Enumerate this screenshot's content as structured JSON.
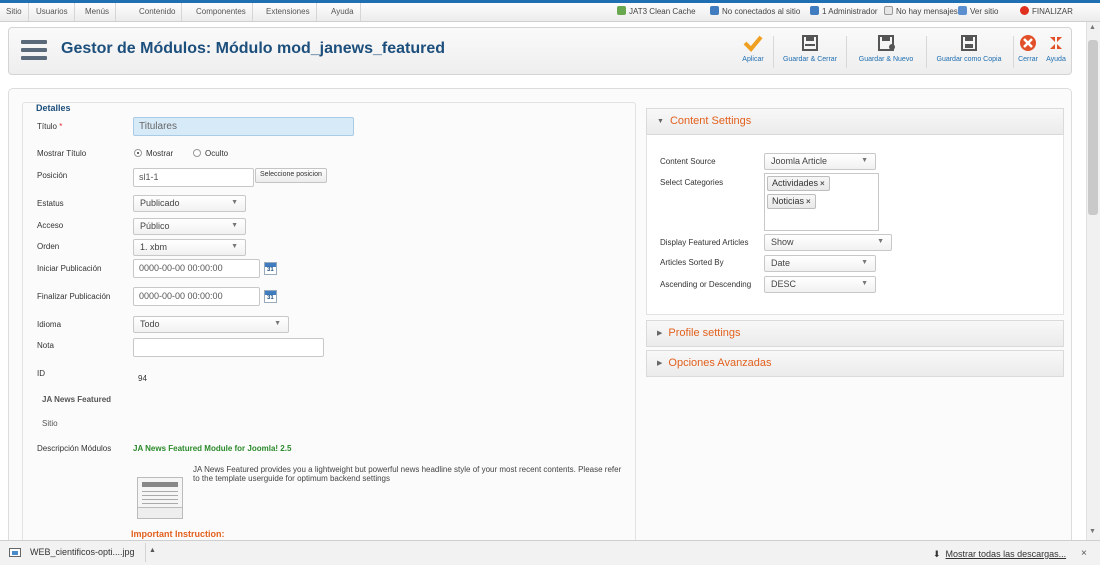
{
  "menu": [
    "Sitio",
    "Usuarios",
    "Menús",
    "Contenido",
    "Componentes",
    "Extensiones",
    "Ayuda"
  ],
  "status": {
    "cache": "JAT3 Clean Cache",
    "connected": "No conectados al sitio",
    "admins": "1 Administrador",
    "messages": "No hay mensajes",
    "view_site": "Ver sitio",
    "logout": "FINALIZAR"
  },
  "header": {
    "title": "Gestor de Módulos: Módulo mod_janews_featured",
    "toolbar": {
      "apply": "Aplicar",
      "save_close": "Guardar & Cerrar",
      "save_new": "Guardar & Nuevo",
      "save_copy": "Guardar como Copia",
      "close": "Cerrar",
      "help": "Ayuda"
    }
  },
  "details": {
    "legend": "Detalles",
    "title_label": "Título",
    "required_mark": "*",
    "title_value": "Titulares",
    "show_title_label": "Mostrar Título",
    "show_option": "Mostrar",
    "hide_option": "Oculto",
    "position_label": "Posición",
    "position_value": "sl1-1",
    "position_button": "Seleccione posicion",
    "status_label": "Estatus",
    "status_value": "Publicado",
    "access_label": "Acceso",
    "access_value": "Público",
    "order_label": "Orden",
    "order_value": "1. xbm",
    "publish_up_label": "Iniciar Publicación",
    "publish_up_value": "0000-00-00 00:00:00",
    "publish_down_label": "Finalizar Publicación",
    "publish_down_value": "0000-00-00 00:00:00",
    "calendar_number": "31",
    "language_label": "Idioma",
    "language_value": "Todo",
    "note_label": "Nota",
    "note_value": "",
    "id_label": "ID",
    "id_value": "94",
    "module_name": "JA News Featured",
    "client": "Sitio",
    "description_label": "Descripción Módulos",
    "description_title": "JA News Featured Module for Joomla! 2.5",
    "description_text": "JA News Featured provides you a lightweight but powerful news headline style of your most recent contents. Please refer to the template userguide for optimum backend settings",
    "important": "Important Instruction:"
  },
  "content_settings": {
    "heading": "Content Settings",
    "source_label": "Content Source",
    "source_value": "Joomla Article",
    "categories_label": "Select Categories",
    "categories": [
      "Actividades",
      "Noticias"
    ],
    "tag_remove": "×",
    "featured_label": "Display Featured Articles",
    "featured_value": "Show",
    "sorted_label": "Articles Sorted By",
    "sorted_value": "Date",
    "order_label": "Ascending or Descending",
    "order_value": "DESC"
  },
  "profile_settings": {
    "heading": "Profile settings"
  },
  "advanced": {
    "heading": "Opciones Avanzadas"
  },
  "downloads": {
    "file": "WEB_cientificos-opti....jpg",
    "show_all": "Mostrar todas las descargas...",
    "close": "×"
  },
  "colors": {
    "accent": "#1d4f7c",
    "section_heading": "#e2611e",
    "description_green": "#2a8a2a"
  }
}
